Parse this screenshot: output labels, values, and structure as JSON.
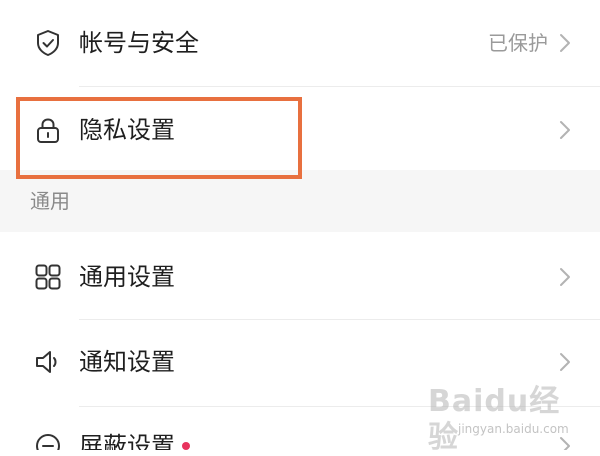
{
  "rows": [
    {
      "label": "帐号与安全",
      "value": "已保护",
      "icon": "shield-check-icon"
    },
    {
      "label": "隐私设置",
      "icon": "lock-icon"
    },
    {
      "label": "通用设置",
      "icon": "grid-icon"
    },
    {
      "label": "通知设置",
      "icon": "speaker-icon"
    },
    {
      "label": "屏蔽设置",
      "icon": "block-icon",
      "badge_color": "#e8335d"
    }
  ],
  "section": {
    "title": "通用"
  },
  "highlight_color": "#e8703f",
  "watermark": {
    "brand": "Baidu经验",
    "url": "jingyan.baidu.com"
  }
}
